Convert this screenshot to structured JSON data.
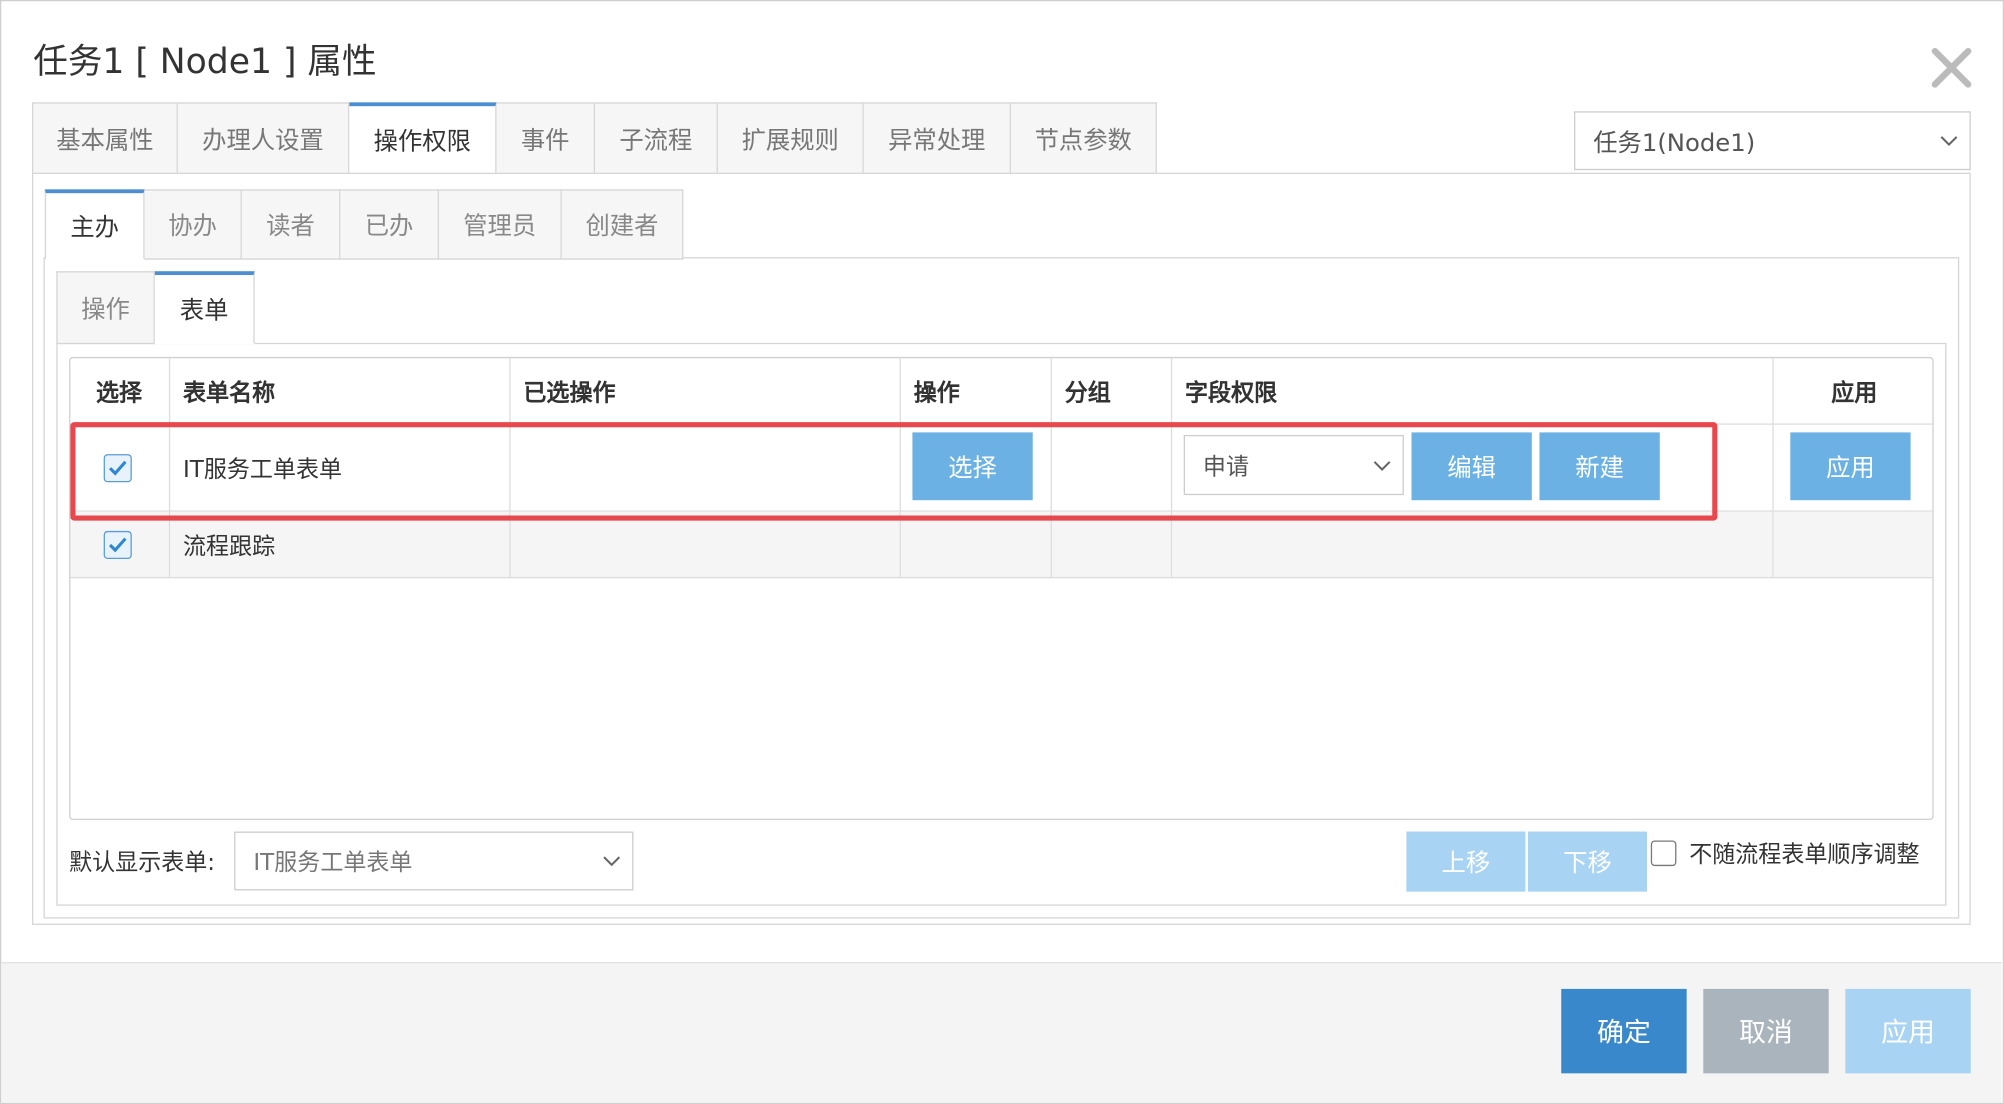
{
  "dialog": {
    "title": "任务1 [ Node1 ] 属性"
  },
  "tabs": [
    {
      "label": "基本属性"
    },
    {
      "label": "办理人设置"
    },
    {
      "label": "操作权限"
    },
    {
      "label": "事件"
    },
    {
      "label": "子流程"
    },
    {
      "label": "扩展规则"
    },
    {
      "label": "异常处理"
    },
    {
      "label": "节点参数"
    }
  ],
  "active_tab": "操作权限",
  "node_select": {
    "value": "任务1(Node1)"
  },
  "role_tabs": [
    {
      "label": "主办"
    },
    {
      "label": "协办"
    },
    {
      "label": "读者"
    },
    {
      "label": "已办"
    },
    {
      "label": "管理员"
    },
    {
      "label": "创建者"
    }
  ],
  "inner_tabs": [
    {
      "label": "操作"
    },
    {
      "label": "表单"
    }
  ],
  "table": {
    "headers": [
      "选择",
      "表单名称",
      "已选操作",
      "操作",
      "分组",
      "字段权限",
      "应用"
    ],
    "rows": [
      {
        "checked": true,
        "name": "IT服务工单表单",
        "selected_ops": "",
        "op_button": "选择",
        "group": "",
        "field_select": "申请",
        "edit_button": "编辑",
        "new_button": "新建",
        "apply_button": "应用"
      },
      {
        "checked": true,
        "name": "流程跟踪",
        "selected_ops": "",
        "group": ""
      }
    ]
  },
  "footer": {
    "default_form_label": "默认显示表单:",
    "default_form_value": "IT服务工单表单",
    "move_up": "上移",
    "move_down": "下移",
    "no_reorder_label": "不随流程表单顺序调整"
  },
  "buttons": {
    "ok": "确定",
    "cancel": "取消",
    "apply": "应用"
  },
  "colors": {
    "accent": "#3a88cc",
    "button_blue": "#6cb1e3",
    "button_pale": "#a9d3f2",
    "cancel_gray": "#aab4bd",
    "highlight_red": "#e8474d"
  }
}
